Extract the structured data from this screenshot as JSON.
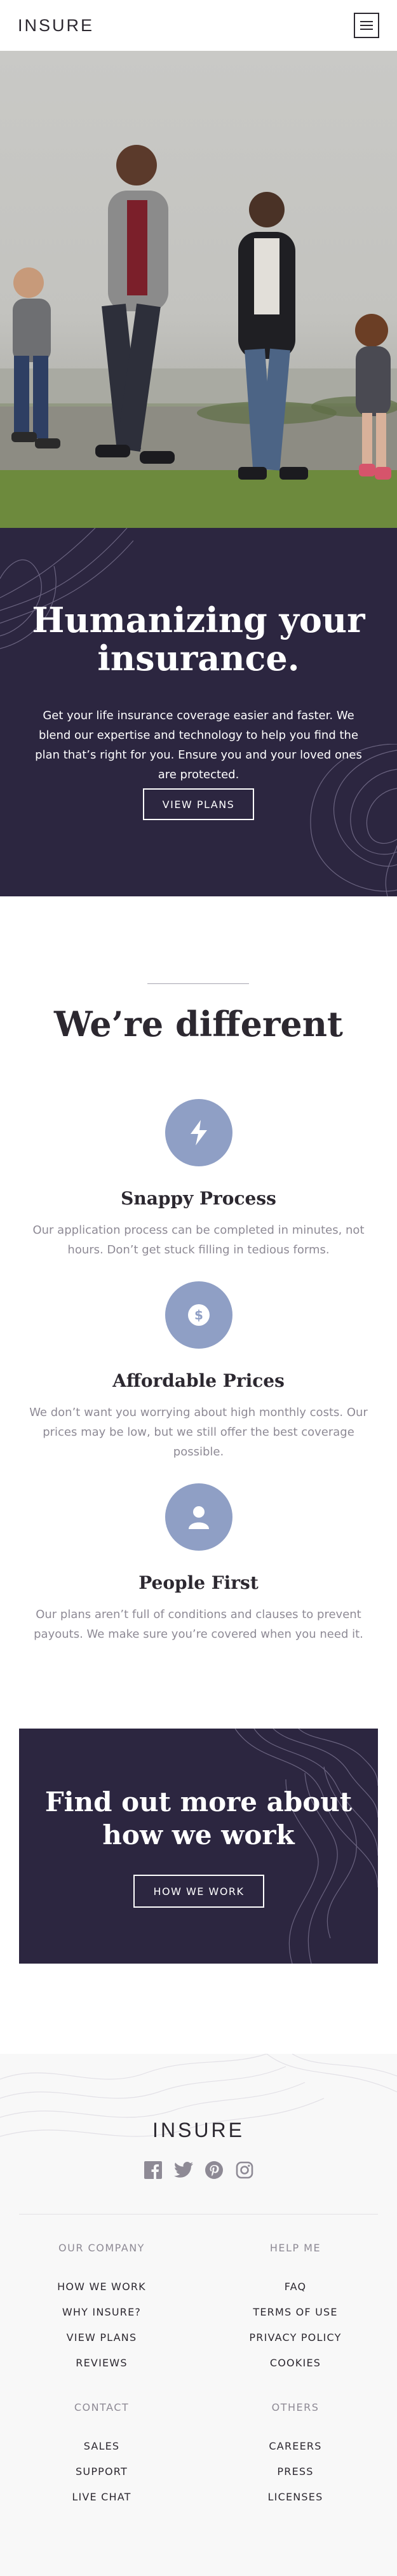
{
  "header": {
    "logo": "INSURE",
    "menu_icon": "hamburger-icon"
  },
  "hero": {
    "title": "Humanizing your insurance.",
    "text": "Get your life insurance coverage easier and faster. We blend our expertise and technology to help you find the plan that’s right for you. Ensure you and your loved ones are protected.",
    "button": "VIEW PLANS"
  },
  "different": {
    "title": "We’re different",
    "features": [
      {
        "icon": "lightning-icon",
        "title": "Snappy Process",
        "text": "Our application process can be completed in minutes, not hours. Don’t get stuck filling in tedious forms."
      },
      {
        "icon": "dollar-icon",
        "title": "Affordable Prices",
        "text": "We don’t want you worrying about high monthly costs. Our prices may be low, but we still offer the best coverage possible."
      },
      {
        "icon": "person-icon",
        "title": "People First",
        "text": "Our plans aren’t full of conditions and clauses to prevent payouts. We make sure you’re covered when you need it."
      }
    ]
  },
  "how_we_work": {
    "title": "Find out more about how we work",
    "button": "HOW WE WORK"
  },
  "footer": {
    "logo": "INSURE",
    "socials": [
      "facebook-icon",
      "twitter-icon",
      "pinterest-icon",
      "instagram-icon"
    ],
    "columns": [
      {
        "heading": "OUR COMPANY",
        "links": [
          "HOW WE WORK",
          "WHY INSURE?",
          "VIEW PLANS",
          "REVIEWS"
        ]
      },
      {
        "heading": "HELP ME",
        "links": [
          "FAQ",
          "TERMS OF USE",
          "PRIVACY POLICY",
          "COOKIES"
        ]
      },
      {
        "heading": "CONTACT",
        "links": [
          "SALES",
          "SUPPORT",
          "LIVE CHAT"
        ]
      },
      {
        "heading": "OTHERS",
        "links": [
          "CAREERS",
          "PRESS",
          "LICENSES"
        ]
      }
    ]
  },
  "colors": {
    "dark_violet": "#2c2640",
    "accent_blue": "#8f9fc5",
    "text_dark": "#2c2830",
    "text_grey": "#8e8a95"
  }
}
